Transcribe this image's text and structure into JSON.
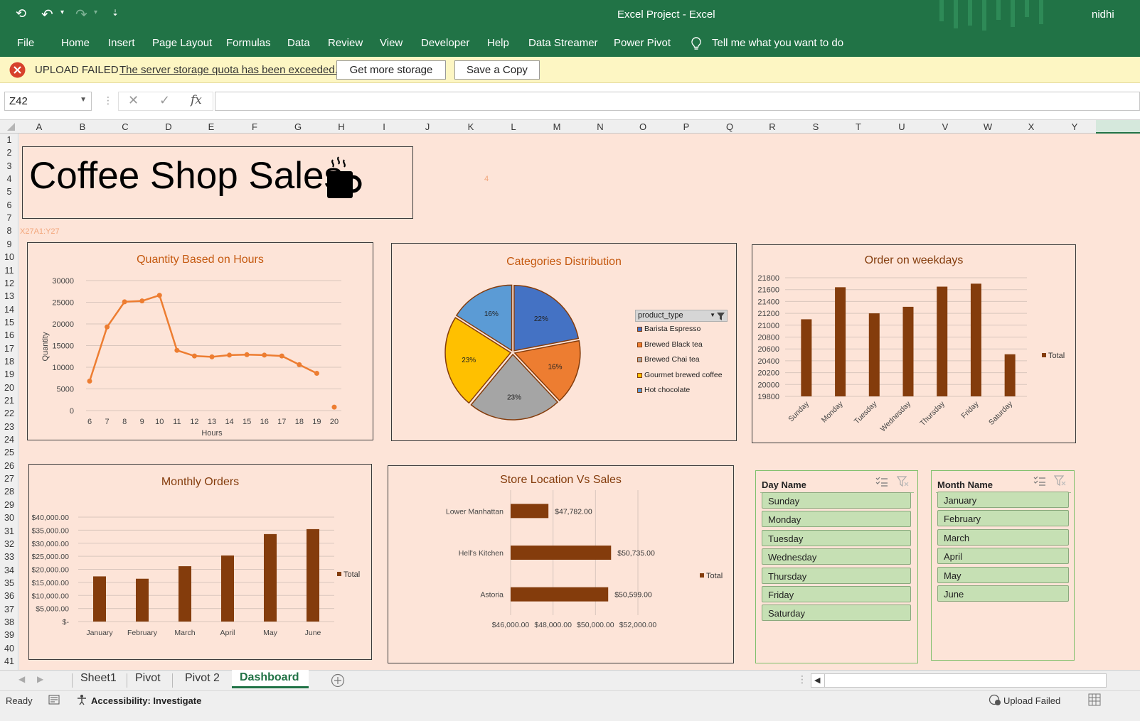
{
  "window": {
    "title": "Excel  Project  -  Excel",
    "user": "nidhi"
  },
  "ribbon": {
    "tabs": [
      "File",
      "Home",
      "Insert",
      "Page Layout",
      "Formulas",
      "Data",
      "Review",
      "View",
      "Developer",
      "Help",
      "Data Streamer",
      "Power Pivot"
    ],
    "tell_me": "Tell me what you want to do"
  },
  "message_bar": {
    "title": "UPLOAD FAILED",
    "text": "The server storage quota has been exceeded.",
    "btn_storage": "Get more storage",
    "btn_copy": "Save a Copy",
    "accent": "#d7412c"
  },
  "formula_bar": {
    "name_box": "Z42",
    "fx": "fx",
    "formula": ""
  },
  "columns": [
    "A",
    "B",
    "C",
    "D",
    "E",
    "F",
    "G",
    "H",
    "I",
    "J",
    "K",
    "L",
    "M",
    "N",
    "O",
    "P",
    "Q",
    "R",
    "S",
    "T",
    "U",
    "V",
    "W",
    "X",
    "Y"
  ],
  "rows": [
    "1",
    "2",
    "3",
    "4",
    "5",
    "6",
    "7",
    "8",
    "9",
    "10",
    "11",
    "12",
    "13",
    "14",
    "15",
    "16",
    "17",
    "18",
    "19",
    "20",
    "21",
    "22",
    "23",
    "24",
    "25",
    "26",
    "27",
    "28",
    "29",
    "30",
    "31",
    "32",
    "33",
    "34",
    "35",
    "36",
    "37",
    "38",
    "39",
    "40",
    "41"
  ],
  "sheet": {
    "background": "#fde4d8",
    "title": "Coffee Shop Sales",
    "stray_value": "4",
    "stray_ref": "X27A1:Y27"
  },
  "charts": {
    "hours": {
      "title": "Quantity Based on Hours",
      "type": "line",
      "xlabel": "Hours",
      "ylabel": "Quantity",
      "yticks": [
        "30000",
        "25000",
        "20000",
        "15000",
        "10000",
        "5000",
        "0"
      ],
      "ylim": [
        0,
        30000
      ],
      "categories": [
        "6",
        "7",
        "8",
        "9",
        "10",
        "11",
        "12",
        "13",
        "14",
        "15",
        "16",
        "17",
        "18",
        "19",
        "20"
      ],
      "values": [
        6800,
        19300,
        25100,
        25300,
        26600,
        13900,
        12600,
        12400,
        12800,
        12900,
        12800,
        12600,
        10600,
        8600,
        800
      ],
      "color": "#ed7d31"
    },
    "categories": {
      "title": "Categories Distribution",
      "type": "pie",
      "legend_title": "product_type",
      "slices": [
        {
          "name": "Barista Espresso",
          "value": 22,
          "label": "22%",
          "color": "#4472c4"
        },
        {
          "name": "Brewed Black tea",
          "value": 16,
          "label": "16%",
          "color": "#ed7d31"
        },
        {
          "name": "Brewed Chai tea",
          "value": 23,
          "label": "23%",
          "color": "#a5a5a5"
        },
        {
          "name": "Gourmet brewed coffee",
          "value": 23,
          "label": "23%",
          "color": "#ffc000"
        },
        {
          "name": "Hot chocolate",
          "value": 16,
          "label": "16%",
          "color": "#5b9bd5"
        }
      ]
    },
    "weekdays": {
      "title": "Order on weekdays",
      "type": "bar",
      "yticks": [
        "21800",
        "21600",
        "21400",
        "21200",
        "21000",
        "20800",
        "20600",
        "20400",
        "20200",
        "20000",
        "19800"
      ],
      "ylim": [
        19800,
        21800
      ],
      "categories": [
        "Sunday",
        "Monday",
        "Tuesday",
        "Wednesday",
        "Thursday",
        "Friday",
        "Saturday"
      ],
      "values": [
        21100,
        21640,
        21200,
        21310,
        21650,
        21700,
        20510
      ],
      "legend": "Total",
      "color": "#843c0c"
    },
    "monthly": {
      "title": "Monthly Orders",
      "type": "bar",
      "yticks": [
        "$40,000.00",
        "$35,000.00",
        "$30,000.00",
        "$25,000.00",
        "$20,000.00",
        "$15,000.00",
        "$10,000.00",
        "$5,000.00",
        "$-"
      ],
      "ylim": [
        0,
        40000
      ],
      "categories": [
        "January",
        "February",
        "March",
        "April",
        "May",
        "June"
      ],
      "values": [
        17300,
        16400,
        21200,
        25300,
        33500,
        35400
      ],
      "legend": "Total",
      "color": "#843c0c"
    },
    "store": {
      "title": "Store Location Vs Sales",
      "type": "bar",
      "orientation": "horizontal",
      "categories": [
        "Lower Manhattan",
        "Hell's Kitchen",
        "Astoria"
      ],
      "values": [
        47782,
        50735,
        50599
      ],
      "labels": [
        "$47,782.00",
        "$50,735.00",
        "$50,599.00"
      ],
      "xticks": [
        "$46,000.00",
        "$48,000.00",
        "$50,000.00",
        "$52,000.00"
      ],
      "xlim": [
        46000,
        52000
      ],
      "legend": "Total",
      "color": "#843c0c"
    }
  },
  "slicers": {
    "day": {
      "title": "Day Name",
      "items": [
        "Sunday",
        "Monday",
        "Tuesday",
        "Wednesday",
        "Thursday",
        "Friday",
        "Saturday"
      ]
    },
    "month": {
      "title": "Month Name",
      "items": [
        "January",
        "February",
        "March",
        "April",
        "May",
        "June"
      ]
    }
  },
  "sheet_tabs": [
    "Sheet1",
    "Pivot",
    "Pivot 2",
    "Dashboard"
  ],
  "status": {
    "ready": "Ready",
    "accessibility": "Accessibility: Investigate",
    "upload": "Upload Failed"
  }
}
